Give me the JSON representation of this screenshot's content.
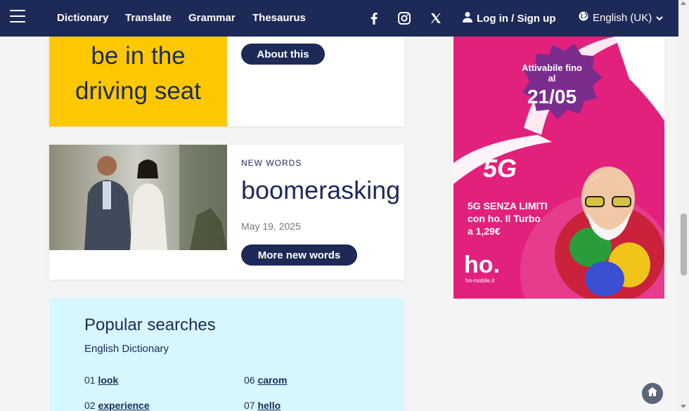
{
  "nav": {
    "links": [
      "Dictionary",
      "Translate",
      "Grammar",
      "Thesaurus"
    ],
    "login_label": "Log in / Sign up",
    "language_label": "English (UK)"
  },
  "idiom_card": {
    "text_line1": "be in the",
    "text_line2": "driving seat",
    "button_label": "About this"
  },
  "new_words_card": {
    "category": "NEW WORDS",
    "word": "boomerasking",
    "date": "May 19, 2025",
    "button_label": "More new words"
  },
  "popular": {
    "title": "Popular searches",
    "subtitle": "English Dictionary",
    "items": [
      {
        "num": "01",
        "word": "look"
      },
      {
        "num": "06",
        "word": "carom"
      },
      {
        "num": "02",
        "word": "experience"
      },
      {
        "num": "07",
        "word": "hello"
      }
    ]
  },
  "ad": {
    "badge_line1": "Attivabile fino al",
    "badge_line2": "21/05",
    "tag": "5G",
    "line1": "5G SENZA LIMITI",
    "line2": "con ho. Il Turbo",
    "line3": "a 1,29€",
    "logo": "ho.",
    "url": "ho-mobile.it"
  },
  "colors": {
    "nav_bg": "#1d2a57",
    "idiom_bg": "#fec800",
    "popular_bg": "#d7f7fe",
    "ad_bg": "#e2217c"
  },
  "icons": [
    "menu-icon",
    "facebook-icon",
    "instagram-icon",
    "x-icon",
    "user-icon",
    "globe-icon",
    "chevron-down-icon",
    "home-icon"
  ]
}
